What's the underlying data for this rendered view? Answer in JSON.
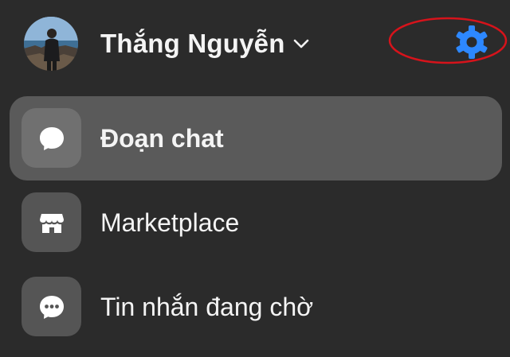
{
  "header": {
    "profile_name": "Thắng Nguyễn",
    "avatar_icon": "avatar",
    "dropdown_icon": "chevron-down-icon",
    "settings_icon": "gear-icon",
    "accent_color": "#2d88ff",
    "annotation_color": "#d6131b"
  },
  "menu": {
    "items": [
      {
        "label": "Đoạn chat",
        "icon": "chat-bubble-icon",
        "active": true
      },
      {
        "label": "Marketplace",
        "icon": "storefront-icon",
        "active": false
      },
      {
        "label": "Tin nhắn đang chờ",
        "icon": "message-requests-icon",
        "active": false
      }
    ]
  }
}
